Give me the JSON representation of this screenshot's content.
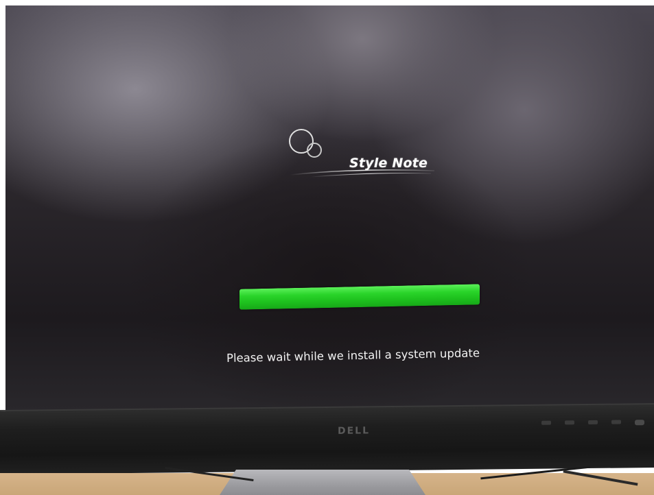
{
  "logo": {
    "brand_text": "Style Note"
  },
  "update": {
    "progress": 1.0,
    "status_text": "Please wait while we install a system update"
  },
  "monitor": {
    "brand": "DELL"
  },
  "colors": {
    "progress_fill": "#2ad42a",
    "screen_background": "#2a262b",
    "text": "#f3f3f3"
  },
  "icons": {
    "logo_mark": "two-circles-icon",
    "power": "power-button-icon"
  }
}
